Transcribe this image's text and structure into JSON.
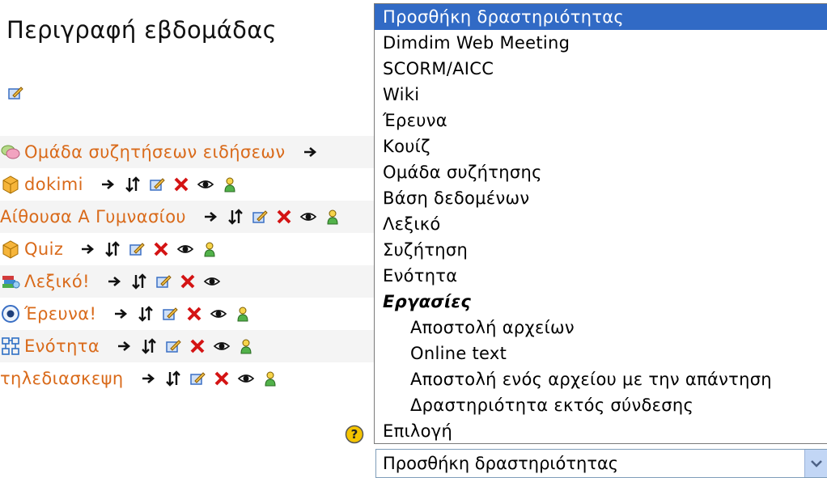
{
  "page": {
    "title": "Περιγραφή εβδομάδας"
  },
  "activities": [
    {
      "label": "Ομάδα συζητήσεων ειδήσεων",
      "icon": "forum-icon",
      "tools": [
        "move-right-icon"
      ]
    },
    {
      "label": "dokimi",
      "icon": "quiz-icon",
      "tools": [
        "move-right-icon",
        "move-updown-icon",
        "edit-icon",
        "delete-icon",
        "visibility-eye-icon",
        "group-mode-icon"
      ]
    },
    {
      "label": "Αίθουσα Α Γυμνασίου",
      "icon": "",
      "tools": [
        "move-right-icon",
        "move-updown-icon",
        "edit-icon",
        "delete-icon",
        "visibility-eye-icon",
        "group-mode-icon"
      ]
    },
    {
      "label": "Quiz",
      "icon": "quiz-icon",
      "tools": [
        "move-right-icon",
        "move-updown-icon",
        "edit-icon",
        "delete-icon",
        "visibility-eye-icon",
        "group-mode-icon"
      ]
    },
    {
      "label": "Λεξικό!",
      "icon": "glossary-icon",
      "tools": [
        "move-right-icon",
        "move-updown-icon",
        "edit-icon",
        "delete-icon",
        "visibility-eye-icon"
      ]
    },
    {
      "label": "Έρευνα!",
      "icon": "survey-icon",
      "tools": [
        "move-right-icon",
        "move-updown-icon",
        "edit-icon",
        "delete-icon",
        "visibility-eye-icon",
        "group-mode-icon"
      ]
    },
    {
      "label": "Ενότητα",
      "icon": "lesson-icon",
      "tools": [
        "move-right-icon",
        "move-updown-icon",
        "edit-icon",
        "delete-icon",
        "visibility-eye-icon",
        "group-mode-icon"
      ]
    },
    {
      "label": "τηλεδιασκεψη",
      "icon": "",
      "tools": [
        "move-right-icon",
        "move-updown-icon",
        "edit-icon",
        "delete-icon",
        "visibility-eye-icon",
        "group-mode-icon"
      ]
    }
  ],
  "dropdown": {
    "options": [
      {
        "label": "Προσθήκη δραστηριότητας",
        "kind": "selected"
      },
      {
        "label": "Dimdim Web Meeting",
        "kind": "option"
      },
      {
        "label": "SCORM/AICC",
        "kind": "option"
      },
      {
        "label": "Wiki",
        "kind": "option"
      },
      {
        "label": "Έρευνα",
        "kind": "option"
      },
      {
        "label": "Κουίζ",
        "kind": "option"
      },
      {
        "label": "Ομάδα συζήτησης",
        "kind": "option"
      },
      {
        "label": "Βάση δεδομένων",
        "kind": "option"
      },
      {
        "label": "Λεξικό",
        "kind": "option"
      },
      {
        "label": "Συζήτηση",
        "kind": "option"
      },
      {
        "label": "Ενότητα",
        "kind": "option"
      },
      {
        "label": "Εργασίες",
        "kind": "group"
      },
      {
        "label": "Αποστολή αρχείων",
        "kind": "child"
      },
      {
        "label": "Online text",
        "kind": "child"
      },
      {
        "label": "Αποστολή ενός αρχείου με την απάντηση",
        "kind": "child"
      },
      {
        "label": "Δραστηριότητα εκτός σύνδεσης",
        "kind": "child"
      },
      {
        "label": "Επιλογή",
        "kind": "option"
      }
    ]
  },
  "select": {
    "value": "Προσθήκη δραστηριότητας",
    "icon": "chevron-down-icon"
  },
  "help": {
    "icon": "help-icon"
  },
  "colors": {
    "link": "#d96a1a",
    "selection": "#316ac5",
    "row_shade": "#f4f4f4"
  }
}
